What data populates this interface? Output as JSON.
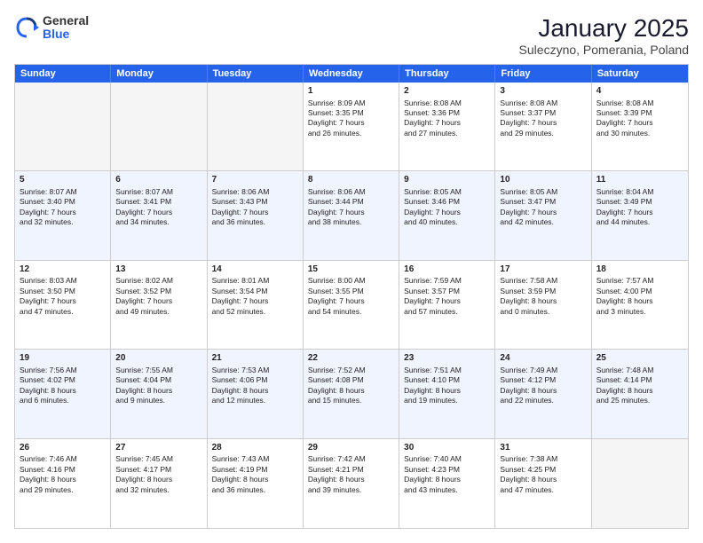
{
  "logo": {
    "general": "General",
    "blue": "Blue"
  },
  "title": "January 2025",
  "subtitle": "Suleczyno, Pomerania, Poland",
  "day_headers": [
    "Sunday",
    "Monday",
    "Tuesday",
    "Wednesday",
    "Thursday",
    "Friday",
    "Saturday"
  ],
  "weeks": [
    {
      "alt": false,
      "days": [
        {
          "num": "",
          "empty": true,
          "lines": []
        },
        {
          "num": "",
          "empty": true,
          "lines": []
        },
        {
          "num": "",
          "empty": true,
          "lines": []
        },
        {
          "num": "1",
          "empty": false,
          "lines": [
            "Sunrise: 8:09 AM",
            "Sunset: 3:35 PM",
            "Daylight: 7 hours",
            "and 26 minutes."
          ]
        },
        {
          "num": "2",
          "empty": false,
          "lines": [
            "Sunrise: 8:08 AM",
            "Sunset: 3:36 PM",
            "Daylight: 7 hours",
            "and 27 minutes."
          ]
        },
        {
          "num": "3",
          "empty": false,
          "lines": [
            "Sunrise: 8:08 AM",
            "Sunset: 3:37 PM",
            "Daylight: 7 hours",
            "and 29 minutes."
          ]
        },
        {
          "num": "4",
          "empty": false,
          "lines": [
            "Sunrise: 8:08 AM",
            "Sunset: 3:39 PM",
            "Daylight: 7 hours",
            "and 30 minutes."
          ]
        }
      ]
    },
    {
      "alt": true,
      "days": [
        {
          "num": "5",
          "empty": false,
          "lines": [
            "Sunrise: 8:07 AM",
            "Sunset: 3:40 PM",
            "Daylight: 7 hours",
            "and 32 minutes."
          ]
        },
        {
          "num": "6",
          "empty": false,
          "lines": [
            "Sunrise: 8:07 AM",
            "Sunset: 3:41 PM",
            "Daylight: 7 hours",
            "and 34 minutes."
          ]
        },
        {
          "num": "7",
          "empty": false,
          "lines": [
            "Sunrise: 8:06 AM",
            "Sunset: 3:43 PM",
            "Daylight: 7 hours",
            "and 36 minutes."
          ]
        },
        {
          "num": "8",
          "empty": false,
          "lines": [
            "Sunrise: 8:06 AM",
            "Sunset: 3:44 PM",
            "Daylight: 7 hours",
            "and 38 minutes."
          ]
        },
        {
          "num": "9",
          "empty": false,
          "lines": [
            "Sunrise: 8:05 AM",
            "Sunset: 3:46 PM",
            "Daylight: 7 hours",
            "and 40 minutes."
          ]
        },
        {
          "num": "10",
          "empty": false,
          "lines": [
            "Sunrise: 8:05 AM",
            "Sunset: 3:47 PM",
            "Daylight: 7 hours",
            "and 42 minutes."
          ]
        },
        {
          "num": "11",
          "empty": false,
          "lines": [
            "Sunrise: 8:04 AM",
            "Sunset: 3:49 PM",
            "Daylight: 7 hours",
            "and 44 minutes."
          ]
        }
      ]
    },
    {
      "alt": false,
      "days": [
        {
          "num": "12",
          "empty": false,
          "lines": [
            "Sunrise: 8:03 AM",
            "Sunset: 3:50 PM",
            "Daylight: 7 hours",
            "and 47 minutes."
          ]
        },
        {
          "num": "13",
          "empty": false,
          "lines": [
            "Sunrise: 8:02 AM",
            "Sunset: 3:52 PM",
            "Daylight: 7 hours",
            "and 49 minutes."
          ]
        },
        {
          "num": "14",
          "empty": false,
          "lines": [
            "Sunrise: 8:01 AM",
            "Sunset: 3:54 PM",
            "Daylight: 7 hours",
            "and 52 minutes."
          ]
        },
        {
          "num": "15",
          "empty": false,
          "lines": [
            "Sunrise: 8:00 AM",
            "Sunset: 3:55 PM",
            "Daylight: 7 hours",
            "and 54 minutes."
          ]
        },
        {
          "num": "16",
          "empty": false,
          "lines": [
            "Sunrise: 7:59 AM",
            "Sunset: 3:57 PM",
            "Daylight: 7 hours",
            "and 57 minutes."
          ]
        },
        {
          "num": "17",
          "empty": false,
          "lines": [
            "Sunrise: 7:58 AM",
            "Sunset: 3:59 PM",
            "Daylight: 8 hours",
            "and 0 minutes."
          ]
        },
        {
          "num": "18",
          "empty": false,
          "lines": [
            "Sunrise: 7:57 AM",
            "Sunset: 4:00 PM",
            "Daylight: 8 hours",
            "and 3 minutes."
          ]
        }
      ]
    },
    {
      "alt": true,
      "days": [
        {
          "num": "19",
          "empty": false,
          "lines": [
            "Sunrise: 7:56 AM",
            "Sunset: 4:02 PM",
            "Daylight: 8 hours",
            "and 6 minutes."
          ]
        },
        {
          "num": "20",
          "empty": false,
          "lines": [
            "Sunrise: 7:55 AM",
            "Sunset: 4:04 PM",
            "Daylight: 8 hours",
            "and 9 minutes."
          ]
        },
        {
          "num": "21",
          "empty": false,
          "lines": [
            "Sunrise: 7:53 AM",
            "Sunset: 4:06 PM",
            "Daylight: 8 hours",
            "and 12 minutes."
          ]
        },
        {
          "num": "22",
          "empty": false,
          "lines": [
            "Sunrise: 7:52 AM",
            "Sunset: 4:08 PM",
            "Daylight: 8 hours",
            "and 15 minutes."
          ]
        },
        {
          "num": "23",
          "empty": false,
          "lines": [
            "Sunrise: 7:51 AM",
            "Sunset: 4:10 PM",
            "Daylight: 8 hours",
            "and 19 minutes."
          ]
        },
        {
          "num": "24",
          "empty": false,
          "lines": [
            "Sunrise: 7:49 AM",
            "Sunset: 4:12 PM",
            "Daylight: 8 hours",
            "and 22 minutes."
          ]
        },
        {
          "num": "25",
          "empty": false,
          "lines": [
            "Sunrise: 7:48 AM",
            "Sunset: 4:14 PM",
            "Daylight: 8 hours",
            "and 25 minutes."
          ]
        }
      ]
    },
    {
      "alt": false,
      "days": [
        {
          "num": "26",
          "empty": false,
          "lines": [
            "Sunrise: 7:46 AM",
            "Sunset: 4:16 PM",
            "Daylight: 8 hours",
            "and 29 minutes."
          ]
        },
        {
          "num": "27",
          "empty": false,
          "lines": [
            "Sunrise: 7:45 AM",
            "Sunset: 4:17 PM",
            "Daylight: 8 hours",
            "and 32 minutes."
          ]
        },
        {
          "num": "28",
          "empty": false,
          "lines": [
            "Sunrise: 7:43 AM",
            "Sunset: 4:19 PM",
            "Daylight: 8 hours",
            "and 36 minutes."
          ]
        },
        {
          "num": "29",
          "empty": false,
          "lines": [
            "Sunrise: 7:42 AM",
            "Sunset: 4:21 PM",
            "Daylight: 8 hours",
            "and 39 minutes."
          ]
        },
        {
          "num": "30",
          "empty": false,
          "lines": [
            "Sunrise: 7:40 AM",
            "Sunset: 4:23 PM",
            "Daylight: 8 hours",
            "and 43 minutes."
          ]
        },
        {
          "num": "31",
          "empty": false,
          "lines": [
            "Sunrise: 7:38 AM",
            "Sunset: 4:25 PM",
            "Daylight: 8 hours",
            "and 47 minutes."
          ]
        },
        {
          "num": "",
          "empty": true,
          "lines": []
        }
      ]
    }
  ]
}
